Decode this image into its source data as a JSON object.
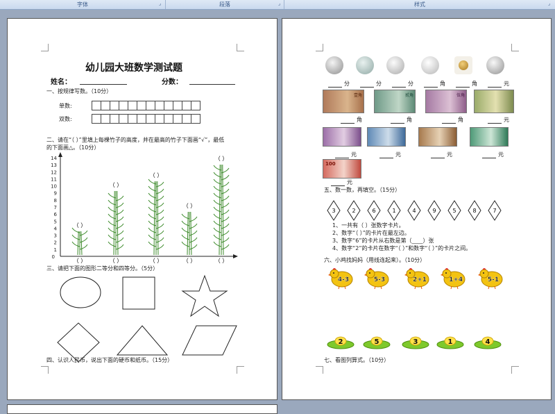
{
  "ribbon": {
    "groups": [
      {
        "label": "字体"
      },
      {
        "label": "段落"
      },
      {
        "label": "样式"
      }
    ]
  },
  "page1": {
    "title": "幼儿园大班数学测试题",
    "name_label": "姓名：",
    "score_label": "分数：",
    "q1": {
      "text": "一、按规律写数。（10分）",
      "odd_label": "单数:",
      "even_label": "双数:"
    },
    "q2": {
      "text_line1": "二、请在“（    ）”里填上每棵竹子的高度，并在最高的竹子下面画“√”，最低",
      "text_line2": "的下面画△。（10分）"
    },
    "axis": {
      "y_ticks": [
        "14",
        "13",
        "12",
        "11",
        "10",
        "9",
        "8",
        "7",
        "6",
        "5",
        "4",
        "3",
        "2",
        "1",
        "0"
      ],
      "paren": "（  ）"
    },
    "q3": {
      "text": "三、请把下面的图形二等分和四等分。（5分）"
    },
    "q4": {
      "text": "四、认识人民币，说出下面的硬币和纸币。（15分）"
    }
  },
  "page2": {
    "coin_units": [
      "分",
      "分",
      "分",
      "角",
      "角",
      "元"
    ],
    "note_units_row1": [
      "角",
      "角",
      "角",
      "元"
    ],
    "note_units_row2": [
      "元",
      "元",
      "元",
      "元"
    ],
    "note_units_row3": [
      "元"
    ],
    "note_labels": {
      "n1": "壹角",
      "n2": "贰角",
      "n3": "伍角",
      "n100": "100"
    },
    "q5": {
      "text": "五、数一数，再填空。（15分）",
      "cards": [
        "3",
        "2",
        "6",
        "1",
        "4",
        "9",
        "5",
        "8",
        "7"
      ],
      "lines": [
        "1、一共有（    ）张数字卡片。",
        "2、数字“（    ）”的卡片在最左边。",
        "3、数字“6”的卡片从右数是第（____）张",
        "4、数字“2”的卡片在数字“（    ）”和数字“（    ）”的卡片之间。"
      ]
    },
    "q6": {
      "text": "六、小鸡找妈妈（用线连起来）。（10分）",
      "chicks": [
        "4-3",
        "5-3",
        "2+1",
        "1+4",
        "5-1"
      ],
      "pads": [
        "2",
        "5",
        "3",
        "1",
        "4"
      ]
    },
    "q7": {
      "text": "七、看图列算式。（10分）"
    }
  },
  "colors": {
    "bamboo": "#3c8a2a",
    "chick": "#f3c312",
    "pad": "#7ec92c",
    "ribbon_text": "#3b5b8a"
  }
}
